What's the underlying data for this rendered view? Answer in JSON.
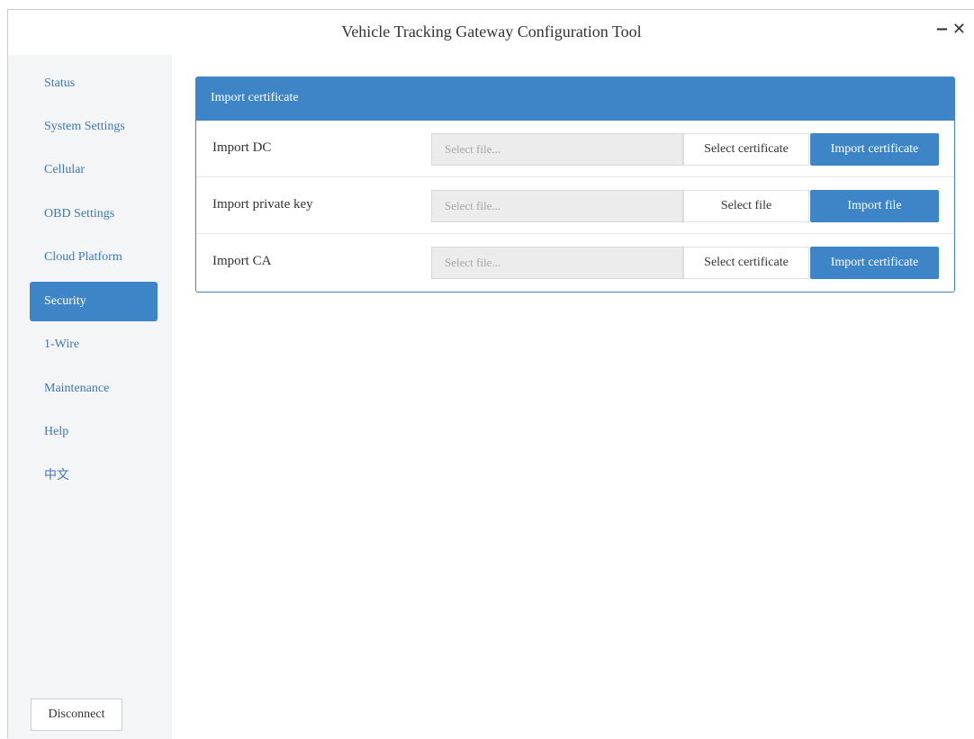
{
  "window": {
    "title": "Vehicle Tracking Gateway Configuration Tool",
    "minimize_glyph": "−",
    "close_glyph": "✕"
  },
  "sidebar": {
    "items": [
      {
        "label": "Status",
        "active": false
      },
      {
        "label": "System Settings",
        "active": false
      },
      {
        "label": "Cellular",
        "active": false
      },
      {
        "label": "OBD Settings",
        "active": false
      },
      {
        "label": "Cloud Platform",
        "active": false
      },
      {
        "label": "Security",
        "active": true
      },
      {
        "label": "1-Wire",
        "active": false
      },
      {
        "label": "Maintenance",
        "active": false
      },
      {
        "label": "Help",
        "active": false
      },
      {
        "label": "中文",
        "active": false
      }
    ],
    "disconnect_label": "Disconnect"
  },
  "panel": {
    "header": "Import certificate",
    "rows": [
      {
        "label": "Import DC",
        "placeholder": "Select file...",
        "select_label": "Select certificate",
        "import_label": "Import certificate"
      },
      {
        "label": "Import private key",
        "placeholder": "Select file...",
        "select_label": "Select file",
        "import_label": "Import file"
      },
      {
        "label": "Import CA",
        "placeholder": "Select file...",
        "select_label": "Select certificate",
        "import_label": "Import certificate"
      }
    ]
  },
  "colors": {
    "accent": "#3d85c6",
    "sidebar_bg": "#f4f5f7",
    "nav_text": "#3f78b4"
  }
}
